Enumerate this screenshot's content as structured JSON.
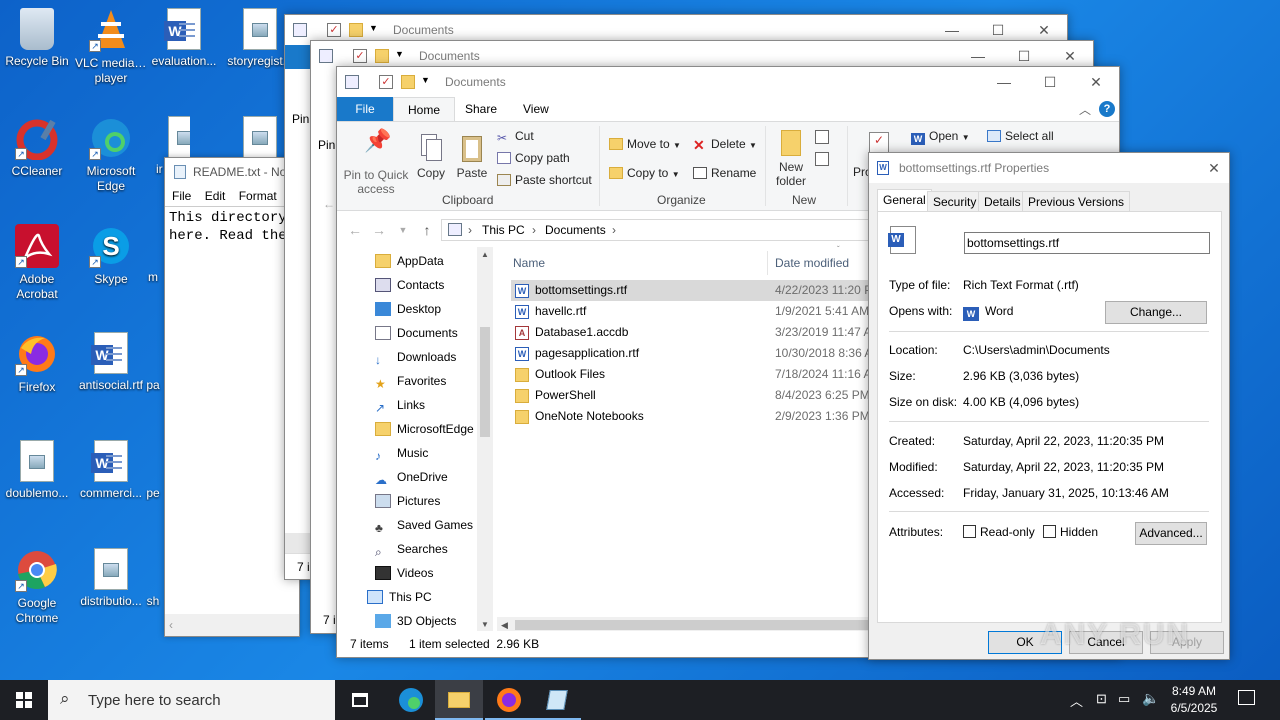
{
  "desktop": {
    "icons": [
      {
        "label": "Recycle Bin",
        "icon": "recycle-bin-icon"
      },
      {
        "label": "VLC media player",
        "icon": "vlc-icon"
      },
      {
        "label": "evaluation...",
        "icon": "word-doc-icon"
      },
      {
        "label": "storyregist...",
        "icon": "image-file-icon"
      },
      {
        "label": "CCleaner",
        "icon": "ccleaner-icon"
      },
      {
        "label": "Microsoft Edge",
        "icon": "edge-icon"
      },
      {
        "label": "Adobe Acrobat",
        "icon": "acrobat-icon"
      },
      {
        "label": "Skype",
        "icon": "skype-icon"
      },
      {
        "label": "Firefox",
        "icon": "firefox-icon"
      },
      {
        "label": "antisocial.rtf",
        "icon": "word-doc-icon"
      },
      {
        "label": "doublemo...",
        "icon": "image-file-icon"
      },
      {
        "label": "commerci...",
        "icon": "word-doc-icon"
      },
      {
        "label": "Google Chrome",
        "icon": "chrome-icon"
      },
      {
        "label": "distributio...",
        "icon": "image-file-icon"
      }
    ]
  },
  "notepad": {
    "title": "README.txt - No",
    "menu": [
      "File",
      "Edit",
      "Format"
    ],
    "content_line1": "This directory",
    "content_line2": "here.  Read the"
  },
  "back_explorers": {
    "title1": "Documents",
    "title2": "Documents",
    "status1": "7 i",
    "status2": "7 i",
    "frag1": "Pin",
    "frag2": "Pin"
  },
  "explorer": {
    "title": "Documents",
    "tabs": [
      "File",
      "Home",
      "Share",
      "View"
    ],
    "ribbon": {
      "pin_quick": "Pin to Quick access",
      "copy": "Copy",
      "paste": "Paste",
      "cut": "Cut",
      "copy_path": "Copy path",
      "paste_shortcut": "Paste shortcut",
      "clipboard": "Clipboard",
      "move_to": "Move to",
      "copy_to": "Copy to",
      "delete": "Delete",
      "rename": "Rename",
      "organize": "Organize",
      "new_folder": "New folder",
      "new": "New",
      "properties_frag": "Pro",
      "open": "Open",
      "select_all": "Select all"
    },
    "address": [
      "This PC",
      "Documents"
    ],
    "nav": [
      "AppData",
      "Contacts",
      "Desktop",
      "Documents",
      "Downloads",
      "Favorites",
      "Links",
      "MicrosoftEdge",
      "Music",
      "OneDrive",
      "Pictures",
      "Saved Games",
      "Searches",
      "Videos",
      "This PC",
      "3D Objects"
    ],
    "columns": {
      "name": "Name",
      "date": "Date modified"
    },
    "files": [
      {
        "name": "bottomsettings.rtf",
        "date": "4/22/2023 11:20 PI",
        "type": "word"
      },
      {
        "name": "havellc.rtf",
        "date": "1/9/2021 5:41 AM",
        "type": "word"
      },
      {
        "name": "Database1.accdb",
        "date": "3/23/2019 11:47 AI",
        "type": "access"
      },
      {
        "name": "pagesapplication.rtf",
        "date": "10/30/2018 8:36 AI",
        "type": "word"
      },
      {
        "name": "Outlook Files",
        "date": "7/18/2024 11:16 AI",
        "type": "folder"
      },
      {
        "name": "PowerShell",
        "date": "8/4/2023 6:25 PM",
        "type": "folder"
      },
      {
        "name": "OneNote Notebooks",
        "date": "2/9/2023 1:36 PM",
        "type": "folder"
      }
    ],
    "status_items": "7 items",
    "status_selected": "1 item selected  2.96 KB"
  },
  "properties": {
    "title": "bottomsettings.rtf Properties",
    "tabs": [
      "General",
      "Security",
      "Details",
      "Previous Versions"
    ],
    "filename": "bottomsettings.rtf",
    "type_label": "Type of file:",
    "type_value": "Rich Text Format (.rtf)",
    "opens_label": "Opens with:",
    "opens_value": "Word",
    "change": "Change...",
    "location_label": "Location:",
    "location_value": "C:\\Users\\admin\\Documents",
    "size_label": "Size:",
    "size_value": "2.96 KB (3,036 bytes)",
    "disk_label": "Size on disk:",
    "disk_value": "4.00 KB (4,096 bytes)",
    "created_label": "Created:",
    "created_value": "Saturday, April 22, 2023, 11:20:35 PM",
    "modified_label": "Modified:",
    "modified_value": "Saturday, April 22, 2023, 11:20:35 PM",
    "accessed_label": "Accessed:",
    "accessed_value": "Friday, January 31, 2025, 10:13:46 AM",
    "attributes_label": "Attributes:",
    "readonly": "Read-only",
    "hidden": "Hidden",
    "advanced": "Advanced...",
    "ok": "OK",
    "cancel": "Cancel",
    "apply": "Apply"
  },
  "taskbar": {
    "search_placeholder": "Type here to search",
    "time": "8:49 AM",
    "date": "6/5/2025"
  },
  "watermark": "ANY RUN"
}
